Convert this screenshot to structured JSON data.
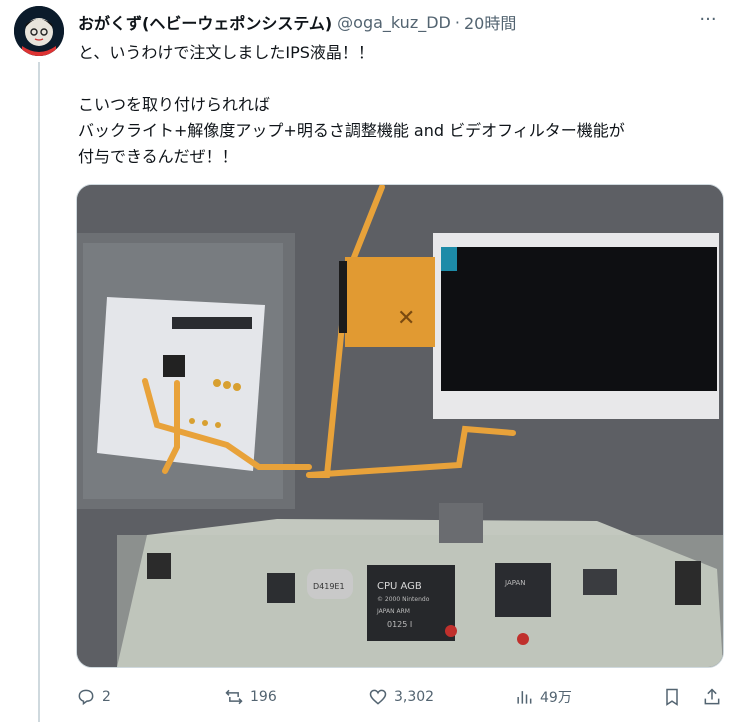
{
  "tweet": {
    "display_name": "おがくず(ヘビーウェポンシステム)",
    "handle": "@oga_kuz_DD",
    "separator": "·",
    "time": "20時間",
    "more": "···",
    "lines": [
      "と、いうわけで注文しましたIPS液晶！！",
      "こいつを取り付けられれば",
      "バックライト+解像度アップ+明るさ調整機能 and ビデオフィルター機能が",
      "付与できるんだぜ！！"
    ]
  },
  "media": {
    "chip_cpu_label": "CPU AGB",
    "chip_cpu_sub1": "© 2000 Nintendo",
    "chip_cpu_sub2": "JAPAN ARM",
    "chip_cpu_sub3": "0125 I",
    "chip_right_label": "JAPAN",
    "oscillator_label": "D419E1"
  },
  "actions": {
    "replies": "2",
    "reposts": "196",
    "likes": "3,302",
    "views": "49万"
  },
  "colors": {
    "text": "#0f1419",
    "secondary": "#536471",
    "border": "#cfd9de",
    "flex_cable": "#e8a23a"
  }
}
